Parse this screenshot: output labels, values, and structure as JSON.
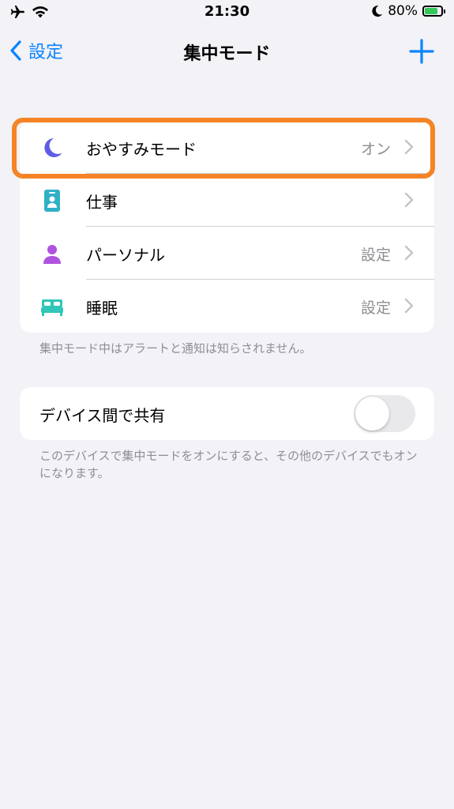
{
  "status_bar": {
    "time": "21:30",
    "battery_percent": "80%",
    "battery_level": 0.8,
    "icons": [
      "airplane-icon",
      "wifi-icon",
      "moon-icon",
      "battery-charging-icon"
    ]
  },
  "nav": {
    "back_label": "設定",
    "title": "集中モード",
    "add_icon": "plus-icon"
  },
  "focus_modes": [
    {
      "label": "おやすみモード",
      "value": "オン",
      "icon": "moon-icon",
      "color": "#5e5ce6"
    },
    {
      "label": "仕事",
      "value": "",
      "icon": "badge-icon",
      "color": "#30b0c7"
    },
    {
      "label": "パーソナル",
      "value": "設定",
      "icon": "person-icon",
      "color": "#af52de"
    },
    {
      "label": "睡眠",
      "value": "設定",
      "icon": "bed-icon",
      "color": "#30c6b8"
    }
  ],
  "focus_footnote": "集中モード中はアラートと通知は知らされません。",
  "share": {
    "label": "デバイス間で共有",
    "enabled": false,
    "footnote": "このデバイスで集中モードをオンにすると、その他のデバイスでもオンになります。"
  },
  "colors": {
    "accent": "#0a84ff",
    "highlight": "#f58426",
    "background": "#f2f2f7",
    "secondary_text": "#8e8e93"
  }
}
